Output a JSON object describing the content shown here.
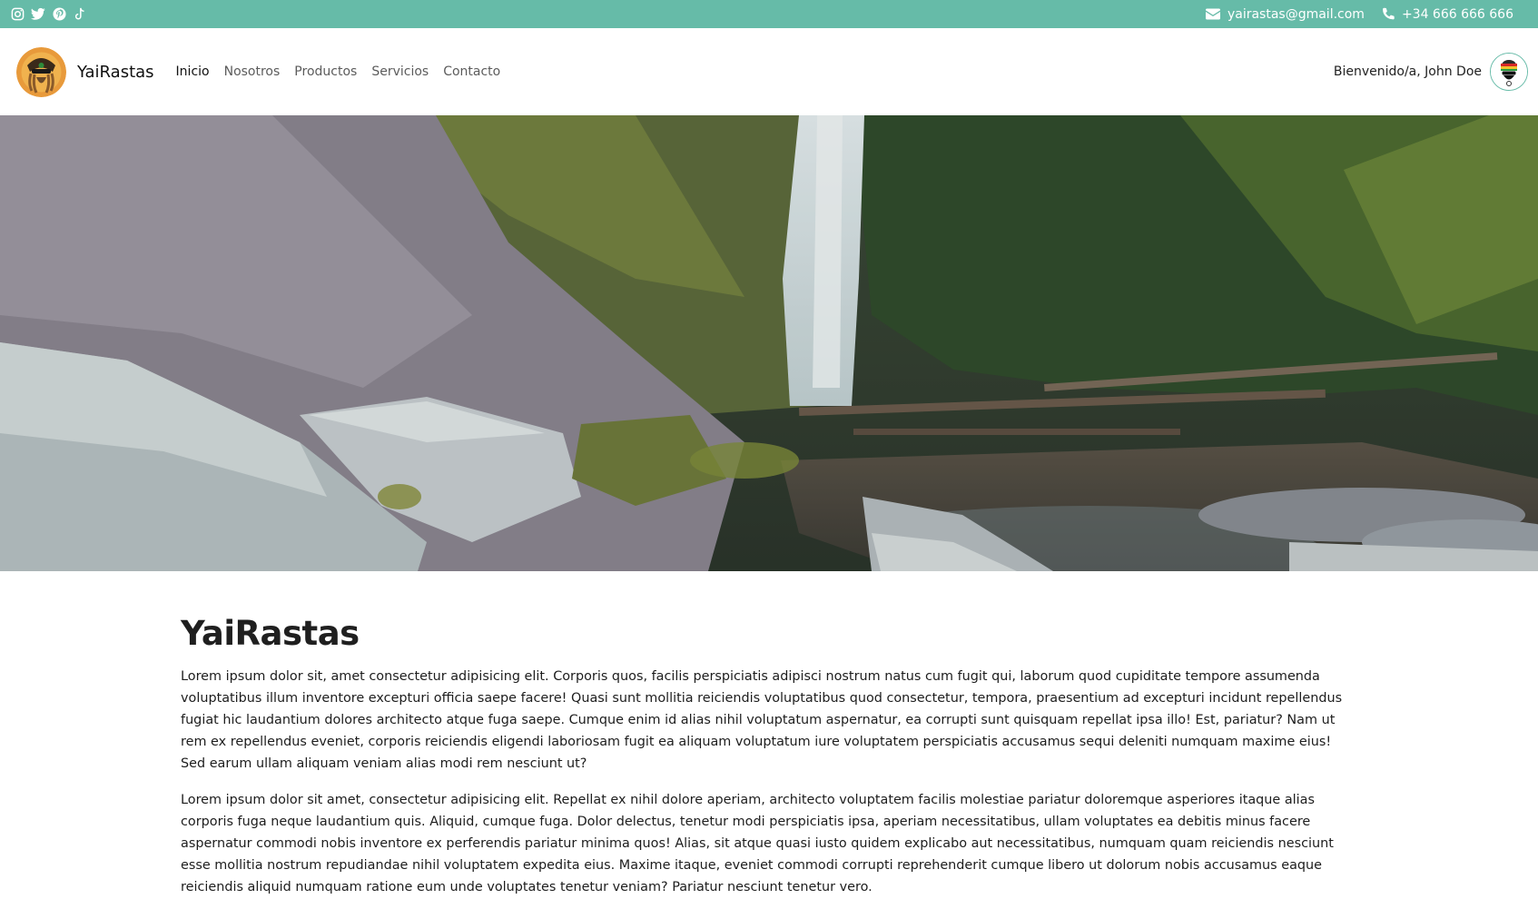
{
  "topbar": {
    "background": "#66bba8",
    "social_icons": [
      "instagram-icon",
      "twitter-icon",
      "pinterest-icon",
      "tiktok-icon"
    ],
    "email": "yairastas@gmail.com",
    "phone": "+34 666 666 666"
  },
  "navbar": {
    "brand": "YaiRastas",
    "links": [
      {
        "label": "Inicio",
        "active": true
      },
      {
        "label": "Nosotros",
        "active": false
      },
      {
        "label": "Productos",
        "active": false
      },
      {
        "label": "Servicios",
        "active": false
      },
      {
        "label": "Contacto",
        "active": false
      }
    ],
    "welcome": "Bienvenido/a, John Doe"
  },
  "hero": {
    "description_icon": "waterfall-landscape-image"
  },
  "main": {
    "title": "YaiRastas",
    "paragraphs": [
      "Lorem ipsum dolor sit, amet consectetur adipisicing elit. Corporis quos, facilis perspiciatis adipisci nostrum natus cum fugit qui, laborum quod cupiditate tempore assumenda voluptatibus illum inventore excepturi officia saepe facere! Quasi sunt mollitia reiciendis voluptatibus quod consectetur, tempora, praesentium ad excepturi incidunt repellendus fugiat hic laudantium dolores architecto atque fuga saepe. Cumque enim id alias nihil voluptatum aspernatur, ea corrupti sunt quisquam repellat ipsa illo! Est, pariatur? Nam ut rem ex repellendus eveniet, corporis reiciendis eligendi laboriosam fugit ea aliquam voluptatum iure voluptatem perspiciatis accusamus sequi deleniti numquam maxime eius! Sed earum ullam aliquam veniam alias modi rem nesciunt ut?",
      "Lorem ipsum dolor sit amet, consectetur adipisicing elit. Repellat ex nihil dolore aperiam, architecto voluptatem facilis molestiae pariatur doloremque asperiores itaque alias corporis fuga neque laudantium quis. Aliquid, cumque fuga. Dolor delectus, tenetur modi perspiciatis ipsa, aperiam necessitatibus, ullam voluptates ea debitis minus facere aspernatur commodi nobis inventore ex perferendis pariatur minima quos! Alias, sit atque quasi iusto quidem explicabo aut necessitatibus, numquam quam reiciendis nesciunt esse mollitia nostrum repudiandae nihil voluptatem expedita eius. Maxime itaque, eveniet commodi corrupti reprehenderit cumque libero ut dolorum nobis accusamus eaque reiciendis aliquid numquam ratione eum unde voluptates tenetur veniam? Pariatur nesciunt tenetur vero."
    ]
  }
}
